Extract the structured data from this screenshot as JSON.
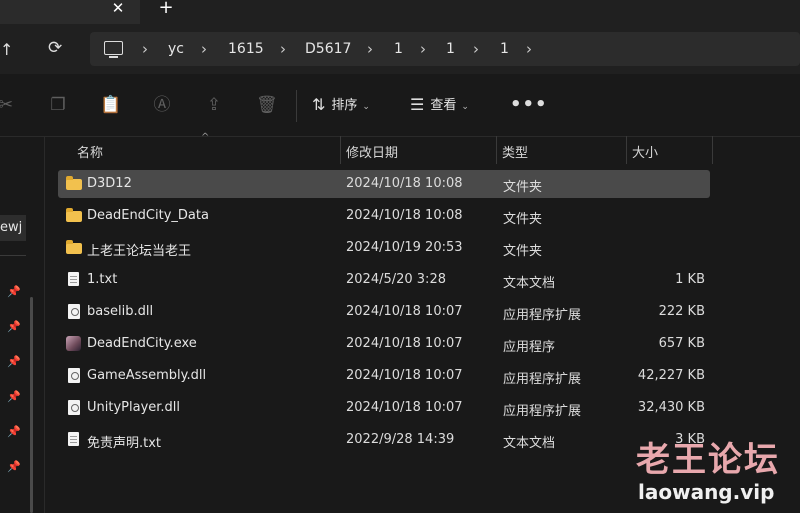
{
  "tabbar": {
    "close_glyph": "✕",
    "new_tab_glyph": "+"
  },
  "nav": {
    "up_glyph": "↑",
    "refresh_glyph": "⟳"
  },
  "breadcrumb": {
    "root_icon": "computer-icon",
    "separator": "›",
    "items": [
      "yc",
      "1615",
      "D5617",
      "1",
      "1",
      "1"
    ]
  },
  "toolbar": {
    "cut_icon": "✂",
    "copy_icon": "❐",
    "paste_icon": "📋",
    "rename_icon": "Ⓐ",
    "share_icon": "⇪",
    "delete_icon": "🗑",
    "sort_icon": "⇅",
    "sort_label": "排序",
    "view_icon": "☰",
    "view_label": "查看",
    "dropdown_glyph": "⌄",
    "more_glyph": "•••"
  },
  "sidebar": {
    "partial_label": "ewj",
    "pin_glyph": "📌"
  },
  "columns": {
    "name": "名称",
    "modified": "修改日期",
    "type": "类型",
    "size": "大小",
    "sort_caret": "^"
  },
  "files": [
    {
      "name": "D3D12",
      "modified": "2024/10/18 10:08",
      "type": "文件夹",
      "size": "",
      "icon": "folder-icon",
      "selected": true
    },
    {
      "name": "DeadEndCity_Data",
      "modified": "2024/10/18 10:08",
      "type": "文件夹",
      "size": "",
      "icon": "folder-icon"
    },
    {
      "name": "上老王论坛当老王",
      "modified": "2024/10/19 20:53",
      "type": "文件夹",
      "size": "",
      "icon": "folder-icon"
    },
    {
      "name": "1.txt",
      "modified": "2024/5/20 3:28",
      "type": "文本文档",
      "size": "1 KB",
      "icon": "text-file-icon"
    },
    {
      "name": "baselib.dll",
      "modified": "2024/10/18 10:07",
      "type": "应用程序扩展",
      "size": "222 KB",
      "icon": "dll-file-icon"
    },
    {
      "name": "DeadEndCity.exe",
      "modified": "2024/10/18 10:07",
      "type": "应用程序",
      "size": "657 KB",
      "icon": "exe-app-icon"
    },
    {
      "name": "GameAssembly.dll",
      "modified": "2024/10/18 10:07",
      "type": "应用程序扩展",
      "size": "42,227 KB",
      "icon": "dll-file-icon"
    },
    {
      "name": "UnityPlayer.dll",
      "modified": "2024/10/18 10:07",
      "type": "应用程序扩展",
      "size": "32,430 KB",
      "icon": "dll-file-icon"
    },
    {
      "name": "免责声明.txt",
      "modified": "2022/9/28 14:39",
      "type": "文本文档",
      "size": "3 KB",
      "icon": "text-file-icon"
    }
  ],
  "watermark": {
    "logo_text": "老王论坛",
    "url_text": "laowang.vip"
  },
  "colors": {
    "folder": "#f2c14e",
    "selection": "#4a4a4a",
    "background": "#191919",
    "watermark": "#e8a8ad"
  }
}
